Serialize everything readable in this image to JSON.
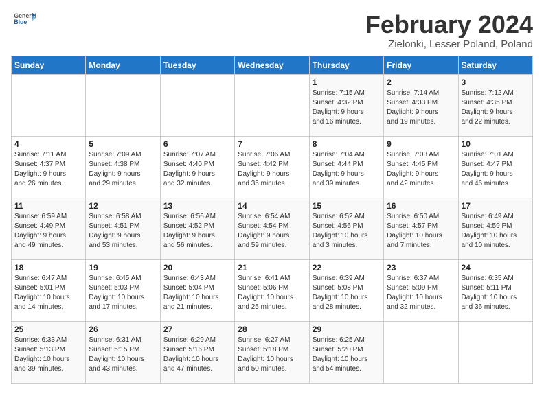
{
  "header": {
    "logo_general": "General",
    "logo_blue": "Blue",
    "month_title": "February 2024",
    "location": "Zielonki, Lesser Poland, Poland"
  },
  "weekdays": [
    "Sunday",
    "Monday",
    "Tuesday",
    "Wednesday",
    "Thursday",
    "Friday",
    "Saturday"
  ],
  "weeks": [
    [
      {
        "day": "",
        "info": ""
      },
      {
        "day": "",
        "info": ""
      },
      {
        "day": "",
        "info": ""
      },
      {
        "day": "",
        "info": ""
      },
      {
        "day": "1",
        "info": "Sunrise: 7:15 AM\nSunset: 4:32 PM\nDaylight: 9 hours\nand 16 minutes."
      },
      {
        "day": "2",
        "info": "Sunrise: 7:14 AM\nSunset: 4:33 PM\nDaylight: 9 hours\nand 19 minutes."
      },
      {
        "day": "3",
        "info": "Sunrise: 7:12 AM\nSunset: 4:35 PM\nDaylight: 9 hours\nand 22 minutes."
      }
    ],
    [
      {
        "day": "4",
        "info": "Sunrise: 7:11 AM\nSunset: 4:37 PM\nDaylight: 9 hours\nand 26 minutes."
      },
      {
        "day": "5",
        "info": "Sunrise: 7:09 AM\nSunset: 4:38 PM\nDaylight: 9 hours\nand 29 minutes."
      },
      {
        "day": "6",
        "info": "Sunrise: 7:07 AM\nSunset: 4:40 PM\nDaylight: 9 hours\nand 32 minutes."
      },
      {
        "day": "7",
        "info": "Sunrise: 7:06 AM\nSunset: 4:42 PM\nDaylight: 9 hours\nand 35 minutes."
      },
      {
        "day": "8",
        "info": "Sunrise: 7:04 AM\nSunset: 4:44 PM\nDaylight: 9 hours\nand 39 minutes."
      },
      {
        "day": "9",
        "info": "Sunrise: 7:03 AM\nSunset: 4:45 PM\nDaylight: 9 hours\nand 42 minutes."
      },
      {
        "day": "10",
        "info": "Sunrise: 7:01 AM\nSunset: 4:47 PM\nDaylight: 9 hours\nand 46 minutes."
      }
    ],
    [
      {
        "day": "11",
        "info": "Sunrise: 6:59 AM\nSunset: 4:49 PM\nDaylight: 9 hours\nand 49 minutes."
      },
      {
        "day": "12",
        "info": "Sunrise: 6:58 AM\nSunset: 4:51 PM\nDaylight: 9 hours\nand 53 minutes."
      },
      {
        "day": "13",
        "info": "Sunrise: 6:56 AM\nSunset: 4:52 PM\nDaylight: 9 hours\nand 56 minutes."
      },
      {
        "day": "14",
        "info": "Sunrise: 6:54 AM\nSunset: 4:54 PM\nDaylight: 9 hours\nand 59 minutes."
      },
      {
        "day": "15",
        "info": "Sunrise: 6:52 AM\nSunset: 4:56 PM\nDaylight: 10 hours\nand 3 minutes."
      },
      {
        "day": "16",
        "info": "Sunrise: 6:50 AM\nSunset: 4:57 PM\nDaylight: 10 hours\nand 7 minutes."
      },
      {
        "day": "17",
        "info": "Sunrise: 6:49 AM\nSunset: 4:59 PM\nDaylight: 10 hours\nand 10 minutes."
      }
    ],
    [
      {
        "day": "18",
        "info": "Sunrise: 6:47 AM\nSunset: 5:01 PM\nDaylight: 10 hours\nand 14 minutes."
      },
      {
        "day": "19",
        "info": "Sunrise: 6:45 AM\nSunset: 5:03 PM\nDaylight: 10 hours\nand 17 minutes."
      },
      {
        "day": "20",
        "info": "Sunrise: 6:43 AM\nSunset: 5:04 PM\nDaylight: 10 hours\nand 21 minutes."
      },
      {
        "day": "21",
        "info": "Sunrise: 6:41 AM\nSunset: 5:06 PM\nDaylight: 10 hours\nand 25 minutes."
      },
      {
        "day": "22",
        "info": "Sunrise: 6:39 AM\nSunset: 5:08 PM\nDaylight: 10 hours\nand 28 minutes."
      },
      {
        "day": "23",
        "info": "Sunrise: 6:37 AM\nSunset: 5:09 PM\nDaylight: 10 hours\nand 32 minutes."
      },
      {
        "day": "24",
        "info": "Sunrise: 6:35 AM\nSunset: 5:11 PM\nDaylight: 10 hours\nand 36 minutes."
      }
    ],
    [
      {
        "day": "25",
        "info": "Sunrise: 6:33 AM\nSunset: 5:13 PM\nDaylight: 10 hours\nand 39 minutes."
      },
      {
        "day": "26",
        "info": "Sunrise: 6:31 AM\nSunset: 5:15 PM\nDaylight: 10 hours\nand 43 minutes."
      },
      {
        "day": "27",
        "info": "Sunrise: 6:29 AM\nSunset: 5:16 PM\nDaylight: 10 hours\nand 47 minutes."
      },
      {
        "day": "28",
        "info": "Sunrise: 6:27 AM\nSunset: 5:18 PM\nDaylight: 10 hours\nand 50 minutes."
      },
      {
        "day": "29",
        "info": "Sunrise: 6:25 AM\nSunset: 5:20 PM\nDaylight: 10 hours\nand 54 minutes."
      },
      {
        "day": "",
        "info": ""
      },
      {
        "day": "",
        "info": ""
      }
    ]
  ]
}
